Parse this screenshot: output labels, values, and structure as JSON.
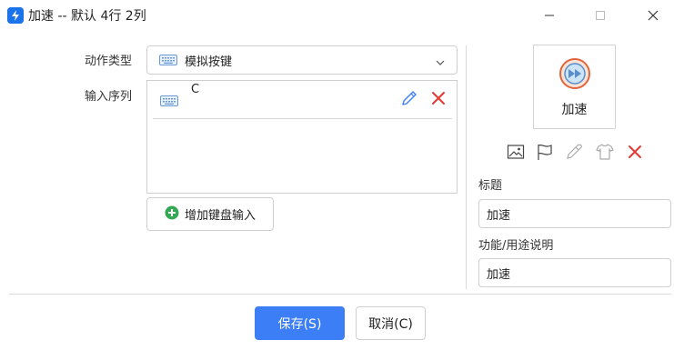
{
  "window": {
    "title": "加速 -- 默认 4行 2列"
  },
  "form": {
    "action_type_label": "动作类型",
    "action_type_value": "模拟按键",
    "sequence_label": "输入序列",
    "sequence_items": [
      {
        "key": "C"
      }
    ],
    "add_key_label": "增加键盘输入"
  },
  "preview": {
    "label": "加速"
  },
  "fields": {
    "title_label": "标题",
    "title_value": "加速",
    "desc_label": "功能/用途说明",
    "desc_value": "加速"
  },
  "footer": {
    "save_label": "保存(S)",
    "cancel_label": "取消(C)"
  },
  "colors": {
    "accent": "#3c7ef5",
    "delete": "#e53935",
    "edit": "#3c7ef5",
    "add": "#34a853",
    "preview_ring": "#e0643c"
  }
}
